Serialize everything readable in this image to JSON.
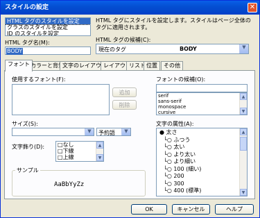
{
  "title": "スタイルの設定",
  "style_list": [
    "HTML タグのスタイルを設定",
    "クラスのスタイルを設定",
    "ID のスタイルを設定"
  ],
  "description": "HTML タグにスタイルを設定します。スタイルはページ全体のタグに適用されます。",
  "html_tag_name_label": "HTML タグ名(M):",
  "html_tag_name_value": "BODY",
  "html_tag_candidates_label": "HTML タグの候補(C):",
  "html_tag_candidate_prefix": "現在のタグ",
  "html_tag_candidate_value": "BODY",
  "tabs": [
    "フォント",
    "カラーと背景",
    "文字のレイアウト",
    "レイアウト",
    "リスト",
    "位置",
    "その他"
  ],
  "font_used_label": "使用するフォント(F):",
  "add_label": "追加",
  "delete_label": "削除",
  "font_candidates_label": "フォントの候補(O):",
  "font_candidates": [
    "serif",
    "sans-serif",
    "monospace",
    "cursive"
  ],
  "size_label": "サイズ(S):",
  "size_value": "",
  "size_unit": "予約語",
  "decoration_label": "文字飾り(D):",
  "decorations": [
    "なし",
    "下線",
    "上線"
  ],
  "sample_label": "サンプル",
  "sample_text": "AaBbYyZz",
  "attributes_label": "文字の属性(A):",
  "attributes_tree": [
    {
      "label": "太さ",
      "level": 0,
      "bullet": "●"
    },
    {
      "label": "ふつう",
      "level": 1
    },
    {
      "label": "太い",
      "level": 1
    },
    {
      "label": "より太い",
      "level": 1
    },
    {
      "label": "より細い",
      "level": 1
    },
    {
      "label": "100 (細い)",
      "level": 1
    },
    {
      "label": "200",
      "level": 1
    },
    {
      "label": "300",
      "level": 1
    },
    {
      "label": "400 (標準)",
      "level": 1
    }
  ],
  "ok_label": "OK",
  "cancel_label": "キャンセル",
  "help_label": "ヘルプ"
}
